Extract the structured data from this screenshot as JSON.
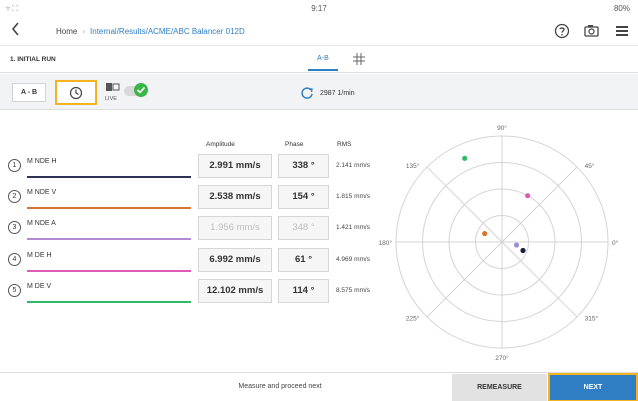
{
  "status": {
    "wifi": "▿ ⛶",
    "time": "9:17",
    "battery": "80%"
  },
  "breadcrumb": {
    "home": "Home",
    "separator": "›",
    "path": "Internal/Results/ACME/ABC Balancer 012D"
  },
  "run": {
    "title": "1. INITIAL RUN",
    "tab_ab": "A-B"
  },
  "toolbar": {
    "ab_label": "A - B",
    "live_label": "LIVE",
    "speed": "2987 1/min"
  },
  "table": {
    "headers": {
      "amplitude": "Amplitude",
      "phase": "Phase",
      "rms": "RMS"
    },
    "rows": [
      {
        "num": "1",
        "name": "M NDE H",
        "amplitude": "2.991 mm/s",
        "phase": "338 °",
        "rms": "2.141 mm/s",
        "color": "#2c3357"
      },
      {
        "num": "2",
        "name": "M NDE V",
        "amplitude": "2.538 mm/s",
        "phase": "154 °",
        "rms": "1.815 mm/s",
        "color": "#d9742b"
      },
      {
        "num": "3",
        "name": "M NDE A",
        "amplitude": "1.956 mm/s",
        "phase": "348 °",
        "rms": "1.421 mm/s",
        "color": "#b28ad6"
      },
      {
        "num": "4",
        "name": "M DE H",
        "amplitude": "6.992 mm/s",
        "phase": "61 °",
        "rms": "4.969 mm/s",
        "color": "#e05bb4"
      },
      {
        "num": "5",
        "name": "M DE V",
        "amplitude": "12.102 mm/s",
        "phase": "114 °",
        "rms": "8.575 mm/s",
        "color": "#2fb86a"
      }
    ]
  },
  "polar": {
    "labels": {
      "a90": "90°",
      "a45": "45°",
      "a0": "0°",
      "a315": "315°",
      "a270": "270°",
      "a225": "225°",
      "a180": "180°",
      "a135": "135°"
    },
    "points": [
      {
        "label": "M NDE H",
        "amplitude": 2.991,
        "phase_deg": 338,
        "color": "#1a1f3c"
      },
      {
        "label": "M NDE V",
        "amplitude": 2.538,
        "phase_deg": 154,
        "color": "#d9742b"
      },
      {
        "label": "M NDE A",
        "amplitude": 1.956,
        "phase_deg": 348,
        "color": "#9b8fd6"
      },
      {
        "label": "M DE H",
        "amplitude": 6.992,
        "phase_deg": 61,
        "color": "#e05bb4"
      },
      {
        "label": "M DE V",
        "amplitude": 12.102,
        "phase_deg": 114,
        "color": "#2fb86a"
      }
    ],
    "max_amplitude": 14
  },
  "bottom": {
    "message": "Measure and proceed next",
    "remeasure": "REMEASURE",
    "next": "NEXT"
  }
}
